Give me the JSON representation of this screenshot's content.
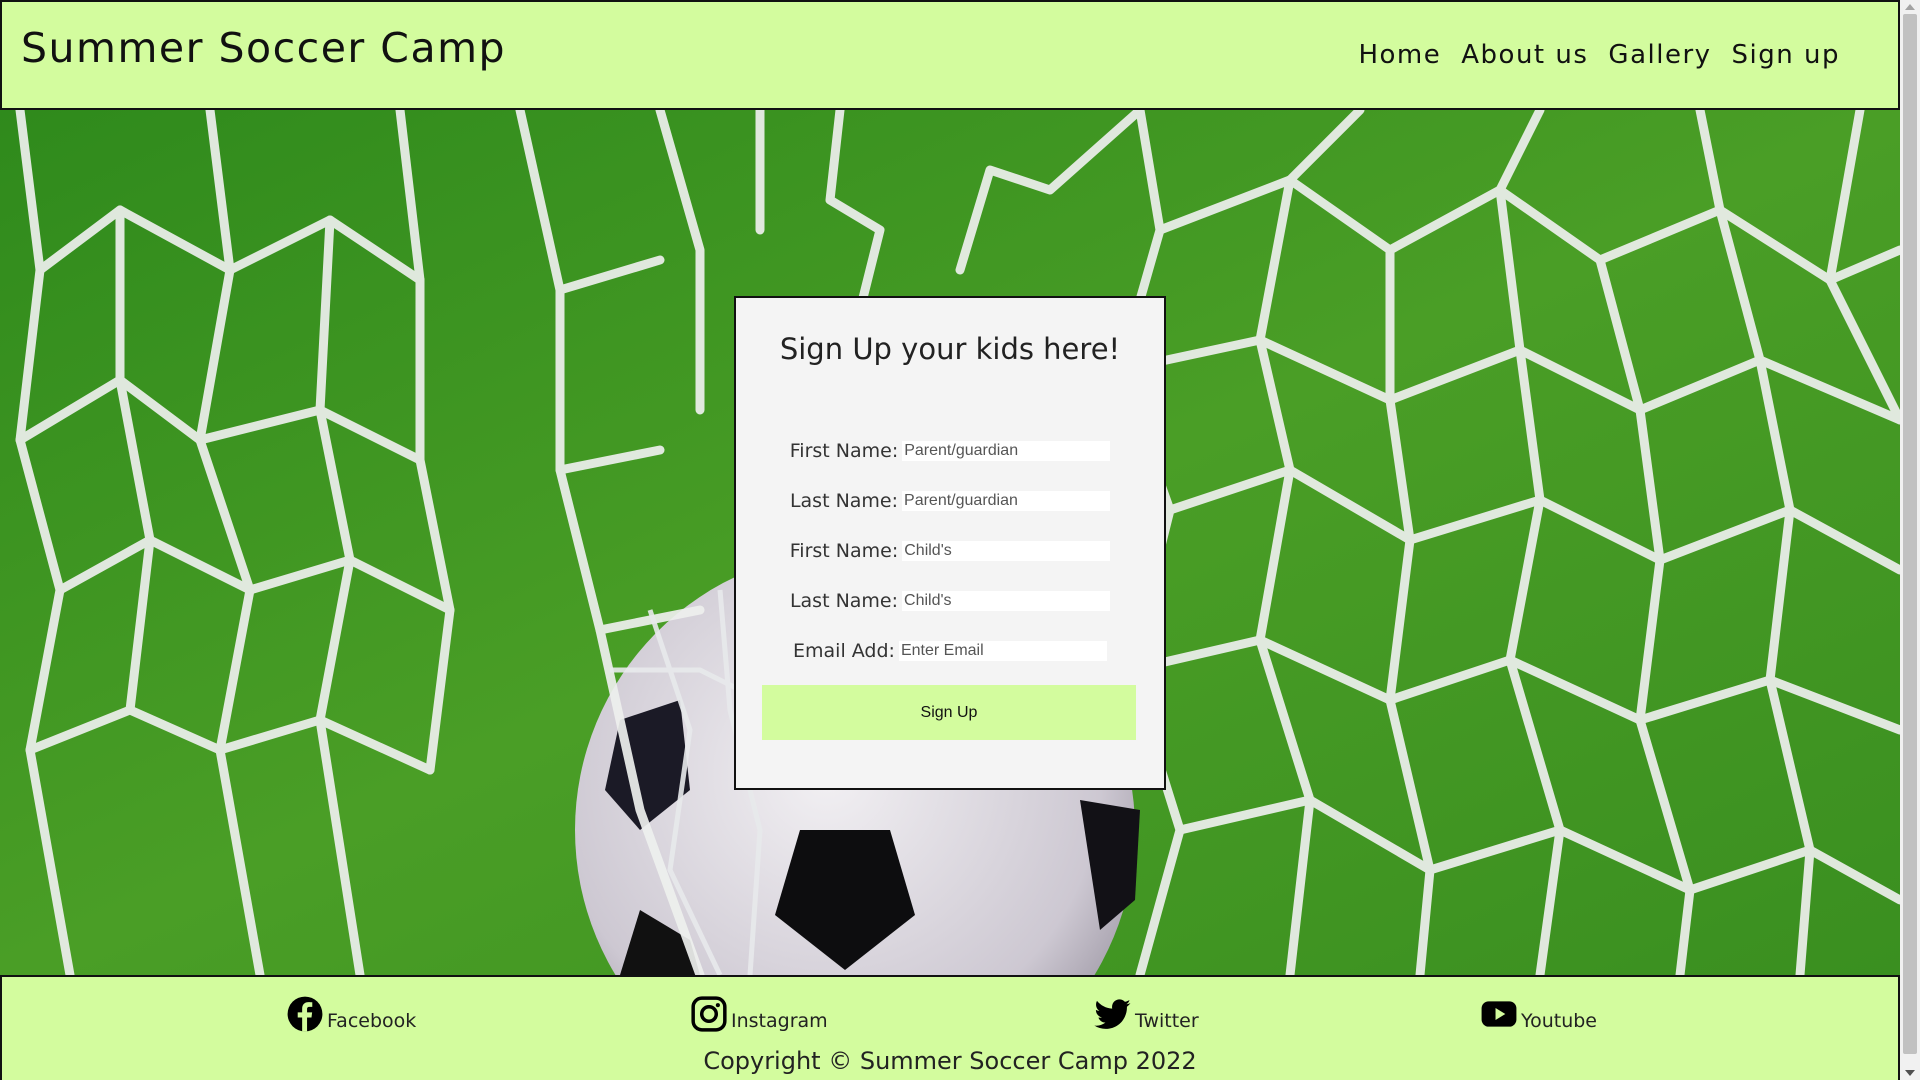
{
  "header": {
    "site_title": "Summer Soccer Camp",
    "nav": [
      "Home",
      "About us",
      "Gallery",
      "Sign up"
    ]
  },
  "hero": {
    "image": "soccer-ball-in-goal-net"
  },
  "signup_form": {
    "heading": "Sign Up your kids here!",
    "fields": [
      {
        "label": "First Name:",
        "placeholder": "Parent/guardian",
        "value": ""
      },
      {
        "label": "Last Name:",
        "placeholder": "Parent/guardian",
        "value": ""
      },
      {
        "label": "First Name:",
        "placeholder": "Child's",
        "value": ""
      },
      {
        "label": "Last Name:",
        "placeholder": "Child's",
        "value": ""
      },
      {
        "label": "Email Add:",
        "placeholder": "Enter Email",
        "value": ""
      }
    ],
    "submit_label": "Sign Up"
  },
  "footer": {
    "social": [
      {
        "icon": "facebook-icon",
        "label": "Facebook"
      },
      {
        "icon": "instagram-icon",
        "label": "Instagram"
      },
      {
        "icon": "twitter-icon",
        "label": "Twitter"
      },
      {
        "icon": "youtube-icon",
        "label": "Youtube"
      }
    ],
    "copyright": "Copyright © Summer Soccer Camp 2022"
  },
  "colors": {
    "accent": "#d3fc9e",
    "card_background": "#f4f4f4",
    "border": "#111111",
    "grass": "#3f8f22"
  }
}
